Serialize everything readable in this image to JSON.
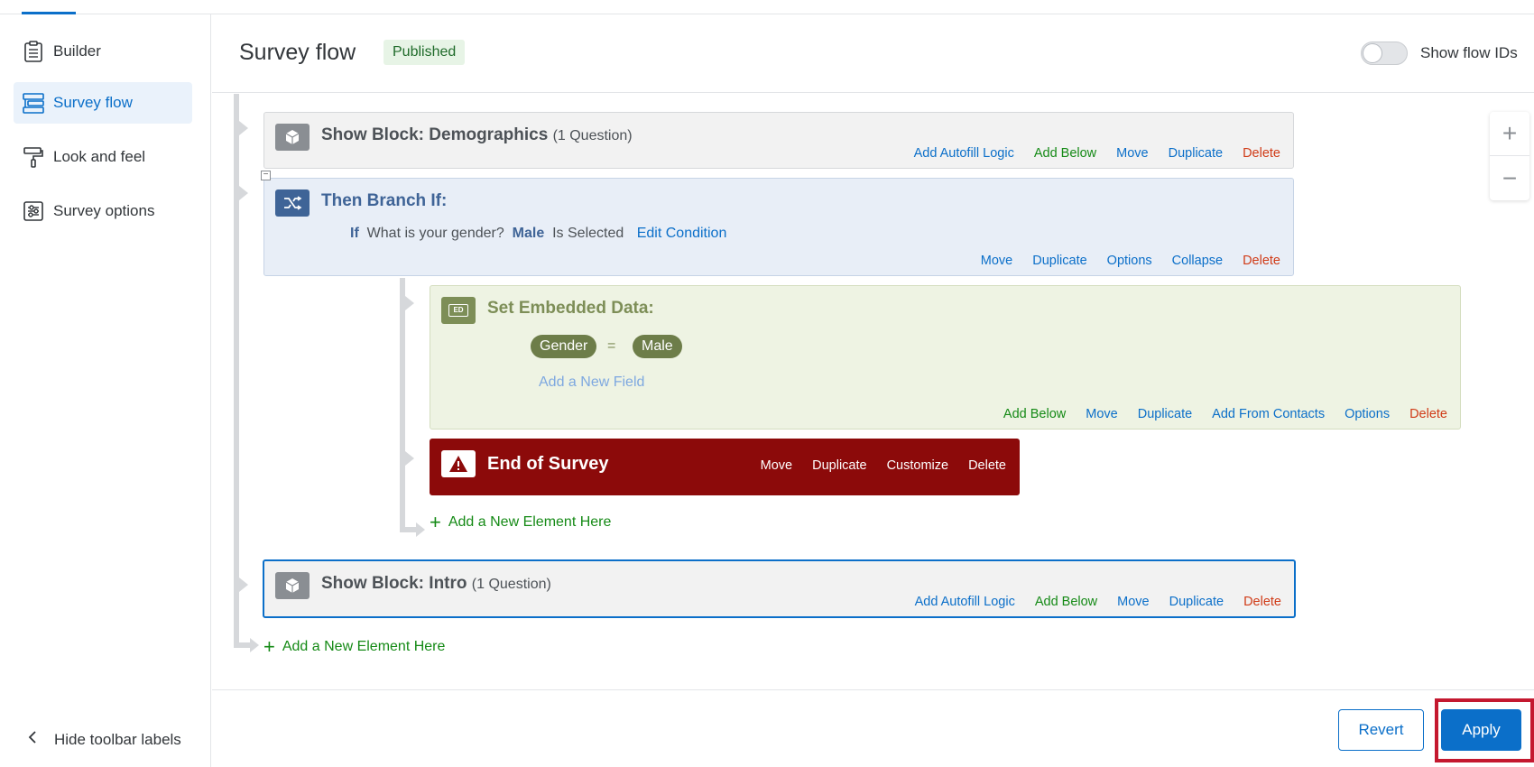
{
  "sidebar": {
    "items": [
      {
        "label": "Builder",
        "icon": "clipboard-icon"
      },
      {
        "label": "Survey flow",
        "icon": "flow-icon"
      },
      {
        "label": "Look and feel",
        "icon": "paint-roller-icon"
      },
      {
        "label": "Survey options",
        "icon": "sliders-icon"
      }
    ],
    "hide_labels": "Hide toolbar labels"
  },
  "header": {
    "title": "Survey flow",
    "status": "Published",
    "toggle_label": "Show flow IDs"
  },
  "flow": {
    "block1": {
      "title": "Show Block: Demographics",
      "sub": "(1 Question)",
      "actions": [
        "Add Autofill Logic",
        "Add Below",
        "Move",
        "Duplicate",
        "Delete"
      ]
    },
    "branch": {
      "title": "Then Branch If:",
      "cond_if": "If",
      "cond_question": "What is your gender?",
      "cond_value": "Male",
      "cond_op": "Is Selected",
      "edit": "Edit Condition",
      "actions": [
        "Move",
        "Duplicate",
        "Options",
        "Collapse",
        "Delete"
      ]
    },
    "embedded": {
      "title": "Set Embedded Data:",
      "icon_text": "ED",
      "field": "Gender",
      "eq": "=",
      "value": "Male",
      "add_field": "Add a New Field",
      "actions": [
        "Add Below",
        "Move",
        "Duplicate",
        "Add From Contacts",
        "Options",
        "Delete"
      ]
    },
    "end": {
      "title": "End of Survey",
      "actions": [
        "Move",
        "Duplicate",
        "Customize",
        "Delete"
      ]
    },
    "add_inner": "Add a New Element Here",
    "block2": {
      "title": "Show Block: Intro",
      "sub": "(1 Question)",
      "actions": [
        "Add Autofill Logic",
        "Add Below",
        "Move",
        "Duplicate",
        "Delete"
      ]
    },
    "add_outer": "Add a New Element Here"
  },
  "footer": {
    "revert": "Revert",
    "apply": "Apply"
  },
  "colors": {
    "accent": "#0b6fc9",
    "end_survey": "#8c0a0a",
    "embedded": "#7d8e57",
    "branch": "#3f6497",
    "highlight": "#c4182f"
  }
}
